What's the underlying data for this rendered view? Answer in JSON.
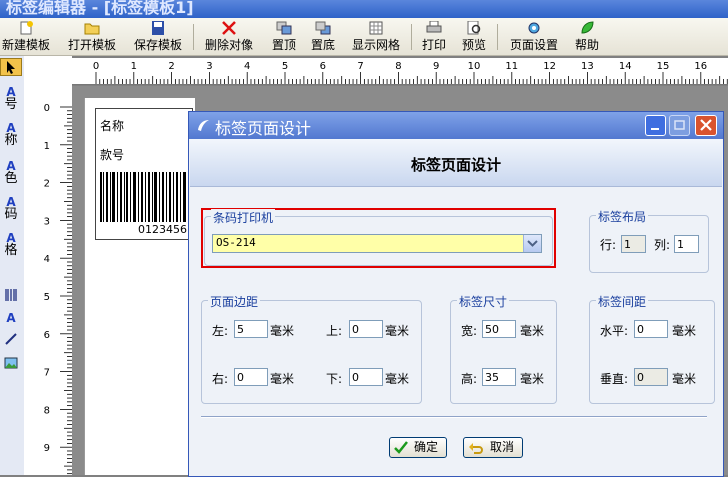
{
  "app": {
    "title": "标签编辑器 - [标签模板1]"
  },
  "toolbar": {
    "items": [
      {
        "label": "新建模板",
        "icon": "new-file-icon"
      },
      {
        "label": "打开模板",
        "icon": "open-folder-icon"
      },
      {
        "label": "保存模板",
        "icon": "save-icon"
      },
      {
        "label": "删除对像",
        "icon": "delete-icon"
      },
      {
        "label": "置顶",
        "icon": "bring-to-front-icon"
      },
      {
        "label": "置底",
        "icon": "send-to-back-icon"
      },
      {
        "label": "显示网格",
        "icon": "grid-icon"
      },
      {
        "label": "打印",
        "icon": "printer-icon"
      },
      {
        "label": "预览",
        "icon": "preview-icon"
      },
      {
        "label": "页面设置",
        "icon": "gear-icon"
      },
      {
        "label": "帮助",
        "icon": "help-icon"
      }
    ]
  },
  "palette": {
    "items": [
      {
        "label": "号"
      },
      {
        "label": "称"
      },
      {
        "label": "色"
      },
      {
        "label": "码"
      },
      {
        "label": "格"
      }
    ]
  },
  "ruler": {
    "h_numbers": [
      "0",
      "1",
      "2",
      "3",
      "4",
      "5",
      "6",
      "7",
      "8",
      "9",
      "10",
      "11",
      "12",
      "13",
      "14",
      "15",
      "16"
    ],
    "v_numbers": [
      "0",
      "1",
      "2",
      "3",
      "4",
      "5",
      "6",
      "7",
      "8",
      "9"
    ]
  },
  "label": {
    "name_text": "名称",
    "sku_text": "款号",
    "barcode_value": "0123456"
  },
  "dialog": {
    "title": "标签页面设计",
    "header": "标签页面设计",
    "printer_group": {
      "title": "条码打印机",
      "selected": "OS-214"
    },
    "layout_group": {
      "title": "标签布局",
      "row_label": "行:",
      "row_value": "1",
      "col_label": "列:",
      "col_value": "1"
    },
    "margin_group": {
      "title": "页面边距",
      "left_label": "左:",
      "left_value": "5",
      "top_label": "上:",
      "top_value": "0",
      "right_label": "右:",
      "right_value": "0",
      "bottom_label": "下:",
      "bottom_value": "0",
      "unit": "毫米"
    },
    "size_group": {
      "title": "标签尺寸",
      "width_label": "宽:",
      "width_value": "50",
      "height_label": "高:",
      "height_value": "35",
      "unit": "毫米"
    },
    "spacing_group": {
      "title": "标签间距",
      "h_label": "水平:",
      "h_value": "0",
      "v_label": "垂直:",
      "v_value": "0",
      "unit": "毫米"
    },
    "ok_label": "确定",
    "cancel_label": "取消"
  }
}
